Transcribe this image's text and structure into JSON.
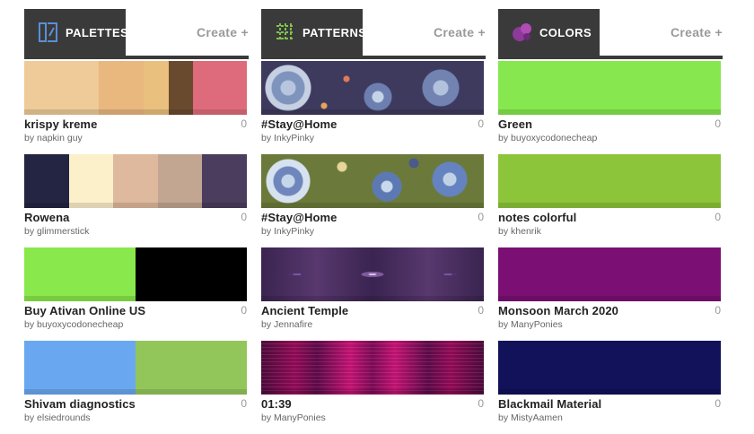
{
  "columns": {
    "palettes": {
      "title": "PALETTES",
      "create_label": "Create +",
      "icon": "palette-icon",
      "items": [
        {
          "title": "krispy kreme",
          "by": "by",
          "author": "napkin guy",
          "count": "0",
          "colors": [
            "#eecb98",
            "#e9b87f",
            "#e9c07e",
            "#6a4a2e",
            "#de6b7b"
          ],
          "widths": [
            36,
            22,
            12,
            12,
            26
          ]
        },
        {
          "title": "Rowena",
          "by": "by",
          "author": "glimmerstick",
          "count": "0",
          "colors": [
            "#232542",
            "#fcf0cb",
            "#deb99d",
            "#c2a692",
            "#4b3d5d"
          ],
          "widths": [
            20,
            20,
            20,
            20,
            20
          ]
        },
        {
          "title": "Buy Ativan Online US",
          "by": "by",
          "author": "buyoxycodonecheap",
          "count": "0",
          "colors": [
            "#89e84b",
            "#000000"
          ],
          "widths": [
            50,
            50
          ]
        },
        {
          "title": "Shivam diagnostics",
          "by": "by",
          "author": "elsiedrounds",
          "count": "0",
          "colors": [
            "#69a8f0",
            "#93c65a"
          ],
          "widths": [
            50,
            50
          ]
        }
      ]
    },
    "patterns": {
      "title": "PATTERNS",
      "create_label": "Create +",
      "icon": "pattern-grid-icon",
      "items": [
        {
          "title": "#Stay@Home",
          "by": "by",
          "author": "InkyPinky",
          "count": "0",
          "texture": "pat-floral-a"
        },
        {
          "title": "#Stay@Home",
          "by": "by",
          "author": "InkyPinky",
          "count": "0",
          "texture": "pat-floral-b"
        },
        {
          "title": "Ancient Temple",
          "by": "by",
          "author": "Jennafire",
          "count": "0",
          "texture": "pat-temple"
        },
        {
          "title": "01:39",
          "by": "by",
          "author": "ManyPonies",
          "count": "0",
          "texture": "pat-striped"
        }
      ]
    },
    "colors": {
      "title": "COLORS",
      "create_label": "Create +",
      "icon": "color-drops-icon",
      "items": [
        {
          "title": "Green",
          "by": "by",
          "author": "buyoxycodonecheap",
          "count": "0",
          "color": "#86e84e"
        },
        {
          "title": "notes colorful",
          "by": "by",
          "author": "khenrik",
          "count": "0",
          "color": "#8cc53a"
        },
        {
          "title": "Monsoon March 2020",
          "by": "by",
          "author": "ManyPonies",
          "count": "0",
          "color": "#7c0f74"
        },
        {
          "title": "Blackmail Material",
          "by": "by",
          "author": "MistyAamen",
          "count": "0",
          "color": "#11125a"
        }
      ]
    }
  },
  "theme": {
    "header_bg": "#3a3a3a",
    "create_color": "#9a9a9a",
    "palette_icon_color": "#5b8fd6",
    "pattern_icon_color": "#7fc24a",
    "colors_icon_color": "#8e3a9a"
  }
}
